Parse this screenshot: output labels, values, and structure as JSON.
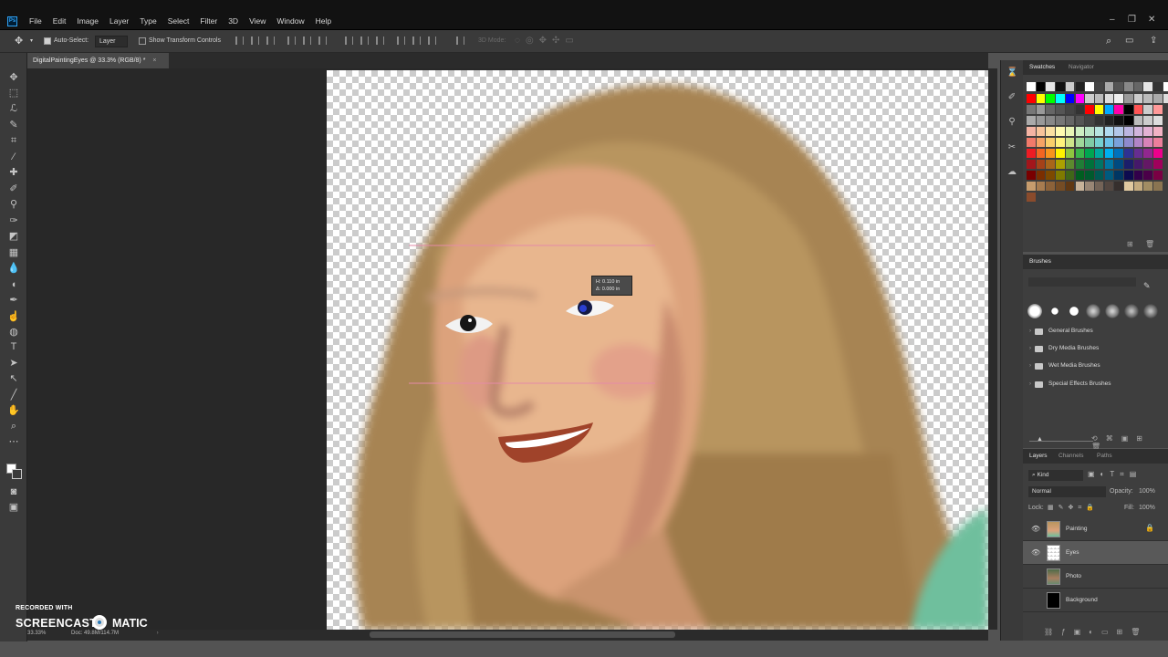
{
  "menubar": {
    "logo": "Ps",
    "items": [
      "File",
      "Edit",
      "Image",
      "Layer",
      "Type",
      "Select",
      "Filter",
      "3D",
      "View",
      "Window",
      "Help"
    ]
  },
  "options": {
    "auto_select_label": "Auto-Select:",
    "auto_select_target": "Layer",
    "show_transform_label": "Show Transform Controls",
    "mode_3d_label": "3D Mode:"
  },
  "document": {
    "tab_title": "DigitalPaintingEyes @ 33.3% (RGB/8) *",
    "zoom": "33.33%",
    "doc_size": "Doc: 49.8M/114.7M"
  },
  "tooltip": {
    "line1": "H: 0.110 in",
    "line2": "Δ: 0.000 in"
  },
  "watermark": {
    "small": "RECORDED WITH",
    "big_left": "SCREENCAST",
    "big_right": "MATIC"
  },
  "swatches_panel": {
    "tabs": [
      "Swatches",
      "Navigator"
    ],
    "row1": [
      "#ffffff",
      "#000000",
      "#e5e5e5",
      "#111111",
      "#cccccc",
      "#222222",
      "#ffffff",
      "#444444",
      "#aaaaaa",
      "#555555",
      "#888888",
      "#666666",
      "#e5e5e5",
      "#333333",
      "#ffffff",
      "#aaaaaa",
      "#cfeaff",
      "#55c8ff"
    ],
    "row2": [
      "#ff0000",
      "#ffff00",
      "#00ff00",
      "#00ffff",
      "#0000ff",
      "#ff00ff",
      "#cccccc",
      "#bbbbbb",
      "#dddddd",
      "#eeeeee",
      "#999999",
      "#cccccc",
      "#bbbbbb",
      "#aaaaaa",
      "#dddddd",
      "#cccccc",
      "#cccccc",
      "#bbbbbb"
    ],
    "row3": [
      "#777777",
      "#999999",
      "#666666",
      "#555555",
      "#444444",
      "#333333",
      "#ff0000",
      "#ffff00",
      "#00aaff",
      "#ff00aa",
      "#000000",
      "#ff5555",
      "#cccccc",
      "#ff9999"
    ],
    "row4": [
      "#aaaaaa",
      "#999999",
      "#888888",
      "#777777",
      "#666666",
      "#555555",
      "#444444",
      "#333333",
      "#222222",
      "#111111",
      "#000000",
      "#bbbbbb",
      "#cccccc",
      "#dddddd"
    ],
    "row5": [
      "#f4b3a3",
      "#f7c39a",
      "#fbe0a1",
      "#fffbb0",
      "#e8f5b5",
      "#cdeec1",
      "#b8e3c6",
      "#b6e3e0",
      "#b0d9ef",
      "#b3c7e8",
      "#bbb5e0",
      "#d0b4dc",
      "#e3b2d4",
      "#f2b2c4"
    ],
    "row6": [
      "#f07a6a",
      "#f5a365",
      "#f9cf6a",
      "#fff37c",
      "#cde58a",
      "#9fd79a",
      "#7fcba5",
      "#74cfd0",
      "#6cc1e8",
      "#7aa2da",
      "#8e8acd",
      "#b284c7",
      "#d882b8",
      "#ec7e9b"
    ],
    "row7": [
      "#ed1c24",
      "#f26522",
      "#f7941d",
      "#fff200",
      "#8dc63f",
      "#39b54a",
      "#00a651",
      "#00a99d",
      "#00aeef",
      "#0072bc",
      "#2e3192",
      "#662d91",
      "#92278f",
      "#ec008c"
    ],
    "row8": [
      "#a3161b",
      "#a54118",
      "#a8651a",
      "#aba000",
      "#5c8a2e",
      "#1f7d36",
      "#00713b",
      "#007566",
      "#0076a3",
      "#004a80",
      "#1b1e6a",
      "#45186a",
      "#641765",
      "#a0005c"
    ],
    "row9": [
      "#790000",
      "#7b2e00",
      "#7d4900",
      "#7f7a00",
      "#406618",
      "#005e20",
      "#005a2d",
      "#005952",
      "#005a7e",
      "#003663",
      "#0d0b4f",
      "#32004b",
      "#4b0049",
      "#7a0044"
    ],
    "row10": [
      "#c69c6d",
      "#a77c50",
      "#8c6239",
      "#754c24",
      "#603813",
      "#c7b299",
      "#998675",
      "#736357",
      "#534741",
      "#362f2d",
      "#e0c9a0",
      "#c4ab7f",
      "#a28d63",
      "#8a7451"
    ],
    "row11": [
      "#8a4b2c"
    ]
  },
  "brushes_panel": {
    "tab": "Brushes",
    "folders": [
      "General Brushes",
      "Dry Media Brushes",
      "Wet Media Brushes",
      "Special Effects Brushes"
    ]
  },
  "layers_panel": {
    "tabs": [
      "Layers",
      "Channels",
      "Paths"
    ],
    "filter": "Kind",
    "blend_mode": "Normal",
    "opacity_label": "Opacity:",
    "opacity_value": "100%",
    "lock_label": "Lock:",
    "fill_label": "Fill:",
    "fill_value": "100%",
    "layers": [
      {
        "name": "Painting",
        "visible": true,
        "locked": true
      },
      {
        "name": "Eyes",
        "visible": true,
        "locked": false,
        "selected": true
      },
      {
        "name": "Photo",
        "visible": false,
        "locked": false
      },
      {
        "name": "Background",
        "visible": false,
        "locked": false
      }
    ]
  }
}
